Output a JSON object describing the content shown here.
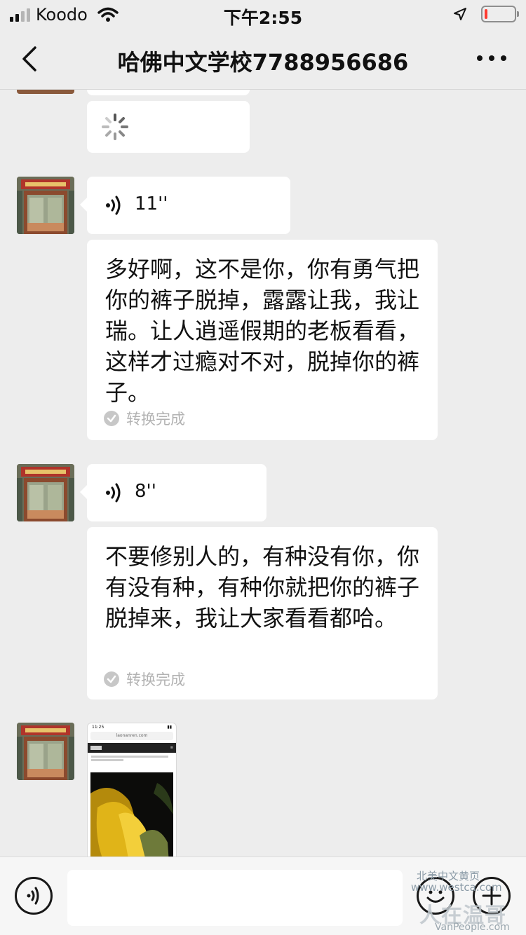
{
  "status_bar": {
    "carrier": "Koodo",
    "time": "下午2:55",
    "icons": [
      "signal-icon",
      "wifi-icon",
      "location-arrow-icon",
      "battery-icon"
    ],
    "battery_level": 0.1
  },
  "nav": {
    "title": "哈佛中文学校7788956686",
    "back_icon": "chevron-left-icon",
    "more_icon": "more-dots-icon"
  },
  "messages": [
    {
      "type": "voice",
      "duration": "11''",
      "transcript": "多好啊，这不是你，你有勇气把你的裤子脱掉，露露让我，我让瑞。让人逍遥假期的老板看看，这样才过瘾对不对，脱掉你的裤子。",
      "status": "转换完成"
    },
    {
      "type": "voice",
      "duration": "8''",
      "transcript": "不要修别人的，有种没有你，你有没有种，有种你就把你的裤子脱掉来，我让大家看看都哈。",
      "status": "转换完成"
    },
    {
      "type": "image",
      "thumbnail": {
        "time": "11:25",
        "url": "laonanren.com"
      }
    }
  ],
  "input_bar": {
    "placeholder": "",
    "watermark_line1": "北美中文黄页",
    "watermark_line2": "www.westca.com",
    "watermark_line3": "人在温哥华",
    "watermark_line4": "VanPeople.com"
  },
  "colors": {
    "background": "#ededed",
    "bubble": "#ffffff",
    "muted_text": "#b2b2b2"
  }
}
